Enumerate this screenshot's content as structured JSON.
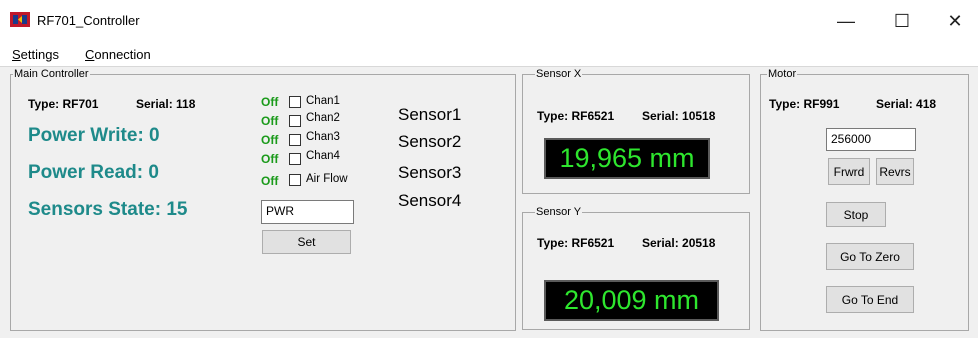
{
  "window": {
    "title": "RF701_Controller",
    "minimize_glyph": "—",
    "maximize_glyph": "☐",
    "close_glyph": "✕"
  },
  "menu": {
    "settings": {
      "first": "S",
      "rest": "ettings"
    },
    "connection": {
      "first": "C",
      "rest": "onnection"
    }
  },
  "main_controller": {
    "legend": "Main Controller",
    "type": "Type: RF701",
    "serial": "Serial: 118",
    "power_write": "Power Write: 0",
    "power_read": "Power Read: 0",
    "sensors_state": "Sensors State: 15",
    "channels": [
      {
        "status": "Off",
        "label": "Chan1"
      },
      {
        "status": "Off",
        "label": "Chan2"
      },
      {
        "status": "Off",
        "label": "Chan3"
      },
      {
        "status": "Off",
        "label": "Chan4"
      },
      {
        "status": "Off",
        "label": "Air Flow"
      }
    ],
    "sensors": [
      "Sensor1",
      "Sensor2",
      "Sensor3",
      "Sensor4"
    ],
    "command_value": "PWR",
    "set_label": "Set"
  },
  "sensor_x": {
    "legend": "Sensor X",
    "type": "Type: RF6521",
    "serial": "Serial: 10518",
    "reading": "19,965 mm"
  },
  "sensor_y": {
    "legend": "Sensor Y",
    "type": "Type: RF6521",
    "serial": "Serial: 20518",
    "reading": "20,009 mm"
  },
  "motor": {
    "legend": "Motor",
    "type": "Type: RF991",
    "serial": "Serial: 418",
    "steps_value": "256000",
    "forward_label": "Frwrd",
    "reverse_label": "Revrs",
    "stop_label": "Stop",
    "go_zero_label": "Go To Zero",
    "go_end_label": "Go To End"
  },
  "colors": {
    "teal_text": "#1e8a8a",
    "off_green": "#1a9a1a",
    "lcd_green": "#2ee62e",
    "lcd_bg": "#000000"
  }
}
